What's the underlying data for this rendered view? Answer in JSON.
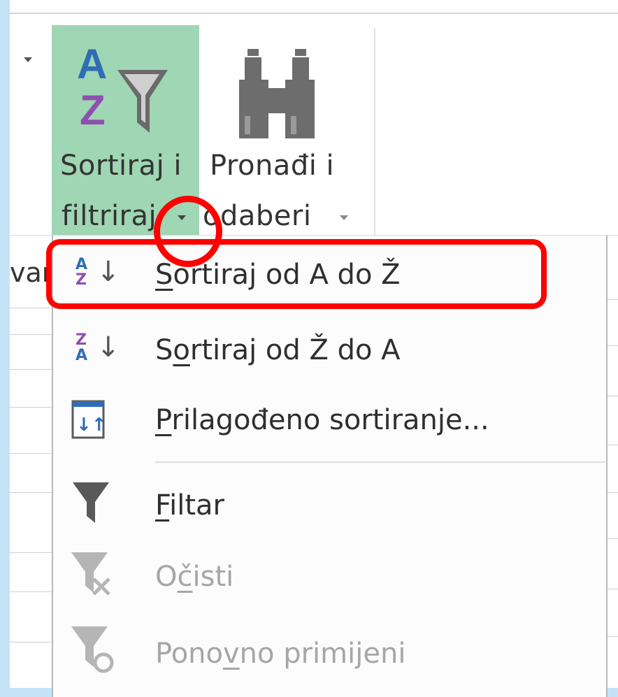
{
  "ribbon": {
    "sort_filter": {
      "line1": "Sortiraj i",
      "line2": "filtriraj"
    },
    "find_select": {
      "line1": "Pronađi i",
      "line2": "odaberi"
    },
    "sheet_left_text": "var"
  },
  "menu": {
    "items": [
      {
        "pre": "",
        "acc": "S",
        "post": "ortiraj od A do Ž",
        "enabled": true,
        "icon": "sort-a-to-z-icon"
      },
      {
        "pre": "S",
        "acc": "o",
        "post": "rtiraj od Ž do A",
        "enabled": true,
        "icon": "sort-z-to-a-icon"
      },
      {
        "pre": "",
        "acc": "P",
        "post": "rilagođeno sortiranje...",
        "enabled": true,
        "icon": "custom-sort-icon"
      },
      {
        "pre": "",
        "acc": "F",
        "post": "iltar",
        "enabled": true,
        "icon": "filter-icon"
      },
      {
        "pre": "O",
        "acc": "č",
        "post": "isti",
        "enabled": false,
        "icon": "clear-filter-icon"
      },
      {
        "pre": "Pono",
        "acc": "v",
        "post": "no primijeni",
        "enabled": false,
        "icon": "reapply-filter-icon"
      }
    ]
  },
  "colors": {
    "accent_selected": "#9fd6b3",
    "annotation": "#ff0000",
    "az_blue": "#2f6eb5",
    "az_purple": "#8e4fb0"
  }
}
